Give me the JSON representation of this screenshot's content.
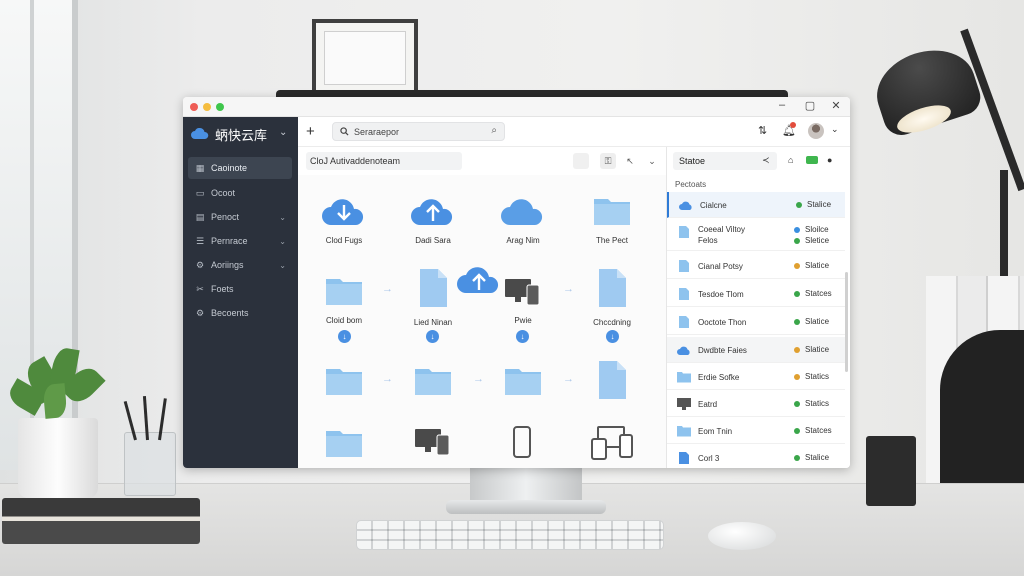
{
  "window": {
    "brand": "蛃快云库",
    "controls": {
      "minimize": "–",
      "maximize": "▢",
      "close": "✕"
    },
    "traffic_colors": [
      "#ee5c55",
      "#f5bd3f",
      "#3fc64c"
    ]
  },
  "sidebar": {
    "items": [
      {
        "label": "Caoinote",
        "icon": "grid-icon"
      },
      {
        "label": "Ocoot",
        "icon": "folder-icon"
      },
      {
        "label": "Penoct",
        "icon": "document-icon"
      },
      {
        "label": "Pernrace",
        "icon": "list-icon"
      },
      {
        "label": "Aoriings",
        "icon": "gear-icon"
      },
      {
        "label": "Foets",
        "icon": "scissors-icon"
      },
      {
        "label": "Becoents",
        "icon": "settings-icon"
      }
    ]
  },
  "topbar": {
    "search_text": "Seraraepor"
  },
  "toolbar": {
    "path": "CloJ Autivaddenoteam"
  },
  "main": {
    "tiles": [
      {
        "label": "Clod Fugs",
        "icon": "cloud-download-icon"
      },
      {
        "label": "Dadi Sara",
        "icon": "cloud-upload-icon"
      },
      {
        "label": "Arag Nim",
        "icon": "cloud-icon"
      },
      {
        "label": "The Pect",
        "icon": "folder-icon"
      },
      {
        "label": "Cloid bom",
        "icon": "folder-icon"
      },
      {
        "label": "Lied Ninan",
        "icon": "document-icon"
      },
      {
        "label": "Pwie",
        "icon": "devices-icon"
      },
      {
        "label": "Chccdning",
        "icon": "document-icon"
      }
    ]
  },
  "panel": {
    "header": "Statoe",
    "title": "Pectoats",
    "rows": [
      {
        "name": "Cialcne",
        "status": "Stalice",
        "color": "#3aa64a",
        "icon": "cloud-icon"
      },
      {
        "name": "Coeeal Viltoy\nFelos",
        "status": "Sloilce\nSletice",
        "color": "#3a8fe0",
        "color2": "#3aa64a",
        "icon": "document-icon"
      },
      {
        "name": "Cianal Potsy",
        "status": "Slatice",
        "color": "#e0a030",
        "icon": "document-icon"
      },
      {
        "name": "Tesdoe Tlom",
        "status": "Statces",
        "color": "#3aa64a",
        "icon": "document-icon"
      },
      {
        "name": "Ooctote Thon",
        "status": "Slatice",
        "color": "#3aa64a",
        "icon": "document-icon"
      },
      {
        "name": "Dwdbte Faies",
        "status": "Slatice",
        "color": "#e0a030",
        "icon": "cloud-icon"
      },
      {
        "name": "Erdie Sofke",
        "status": "Statics",
        "color": "#e0a030",
        "icon": "folder-icon"
      },
      {
        "name": "Eatrd",
        "status": "Statics",
        "color": "#3aa64a",
        "icon": "monitor-icon"
      },
      {
        "name": "Eom Tnin",
        "status": "Statces",
        "color": "#3aa64a",
        "icon": "folder-icon"
      },
      {
        "name": "Corl 3",
        "status": "Stalice",
        "color": "#3aa64a",
        "icon": "document-icon"
      }
    ]
  },
  "colors": {
    "accent": "#4a90e2",
    "sidebar": "#2b313c",
    "folder": "#8ec3ee"
  }
}
